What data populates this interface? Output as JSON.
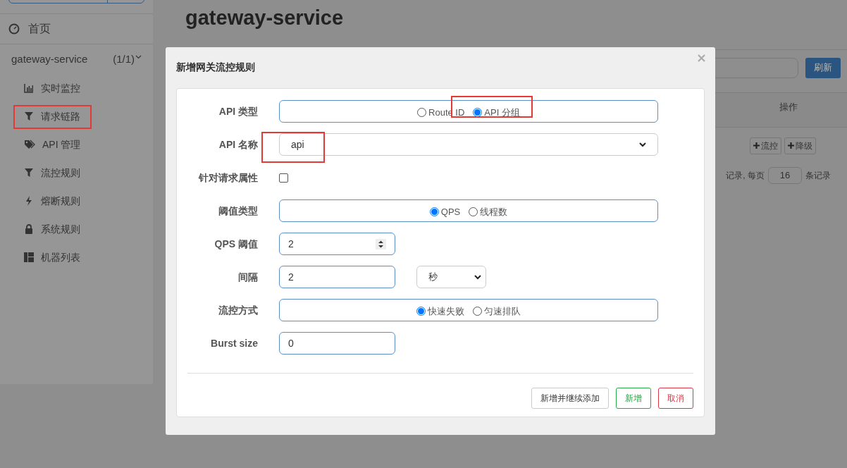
{
  "page": {
    "title": "gateway-service"
  },
  "sidebar": {
    "home": "首页",
    "app": {
      "name": "gateway-service",
      "count": "(1/1)",
      "expanded": true
    },
    "items": [
      {
        "label": "实时监控",
        "kind": "chart"
      },
      {
        "label": "请求链路",
        "kind": "filter"
      },
      {
        "label": "API 管理",
        "kind": "tag"
      },
      {
        "label": "流控规则",
        "kind": "filter"
      },
      {
        "label": "熔断规则",
        "kind": "bolt"
      },
      {
        "label": "系统规则",
        "kind": "lock"
      },
      {
        "label": "机器列表",
        "kind": "grid"
      }
    ]
  },
  "toolbar": {
    "refresh_button": "刷新"
  },
  "table": {
    "columns": [
      "操作"
    ],
    "rows": [
      {
        "actions": [
          "流控",
          "降级"
        ]
      }
    ]
  },
  "pagination": {
    "text_before": "记录, 每页",
    "page_size": "16",
    "text_after": "条记录"
  },
  "modal": {
    "title": "新增网关流控规则",
    "fields": [
      {
        "kind": "radio",
        "label": "API 类型",
        "options": [
          {
            "label": "Route ID",
            "selected": false
          },
          {
            "label": "API 分组",
            "selected": true
          }
        ]
      },
      {
        "kind": "select",
        "label": "API 名称",
        "value": "api"
      },
      {
        "kind": "checkbox",
        "label": "针对请求属性",
        "checked": false
      },
      {
        "kind": "radio",
        "label": "阈值类型",
        "options": [
          {
            "label": "QPS",
            "selected": true
          },
          {
            "label": "线程数",
            "selected": false
          }
        ]
      },
      {
        "kind": "spinner",
        "label": "QPS 阈值",
        "value": "2"
      },
      {
        "kind": "interval",
        "label": "间隔",
        "value": "2",
        "unit": "秒"
      },
      {
        "kind": "radio",
        "label": "流控方式",
        "options": [
          {
            "label": "快速失败",
            "selected": true
          },
          {
            "label": "匀速排队",
            "selected": false
          }
        ]
      },
      {
        "kind": "text",
        "label": "Burst size",
        "value": "0"
      }
    ],
    "buttons": [
      {
        "label": "新增并继续添加",
        "kind": "default"
      },
      {
        "label": "新增",
        "kind": "success"
      },
      {
        "label": "取消",
        "kind": "danger"
      }
    ]
  }
}
